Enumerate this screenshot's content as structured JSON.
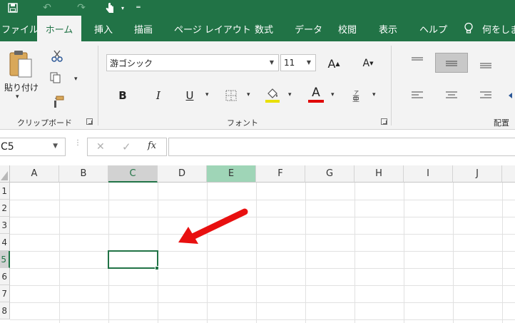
{
  "colors": {
    "brand": "#217346",
    "ribbon": "#f3f3f3",
    "font_underline": "#e8e000",
    "font_color": "#e00000",
    "arrow": "#e81010",
    "highlight_col": "#9fd5b7"
  },
  "qat": {
    "icons": [
      "save-icon",
      "undo-icon",
      "redo-icon",
      "touch-mode-icon",
      "customize-icon"
    ]
  },
  "tabs": [
    "ファイル",
    "ホーム",
    "挿入",
    "描画",
    "ページ レイアウト",
    "数式",
    "データ",
    "校閲",
    "表示",
    "ヘルプ"
  ],
  "active_tab": "ホーム",
  "tell_me": "何をします",
  "clipboard": {
    "paste_label": "貼り付け",
    "group_label": "クリップボード"
  },
  "font": {
    "name": "游ゴシック",
    "size": "11",
    "group_label": "フォント",
    "bold": "B",
    "italic": "I",
    "underline": "U",
    "grow": "A",
    "shrink": "A",
    "color_letter": "A"
  },
  "alignment": {
    "group_label": "配置"
  },
  "formula_bar": {
    "name_box": "C5",
    "cancel": "✕",
    "enter": "✓",
    "fx": "fx",
    "formula": ""
  },
  "columns": [
    "A",
    "B",
    "C",
    "D",
    "E",
    "F",
    "G",
    "H",
    "I",
    "J"
  ],
  "rows": [
    "1",
    "2",
    "3",
    "4",
    "5",
    "6",
    "7",
    "8"
  ],
  "selected_cell": "C5"
}
